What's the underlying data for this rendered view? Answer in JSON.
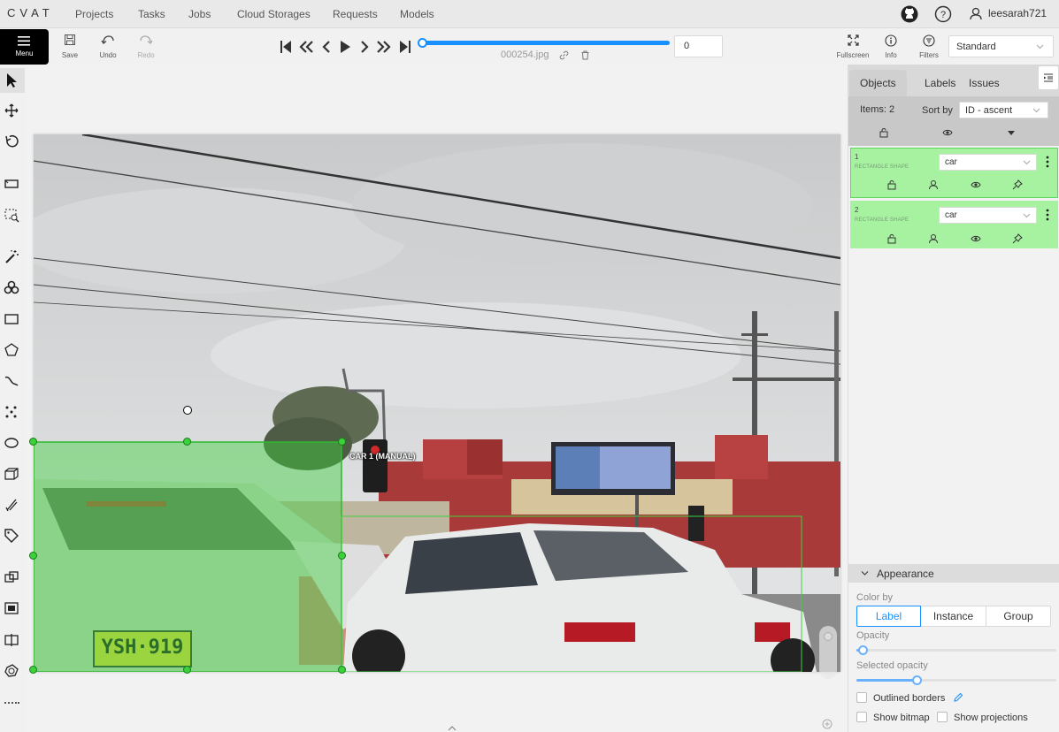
{
  "app": {
    "logo": "CVAT"
  },
  "nav": {
    "links": [
      "Projects",
      "Tasks",
      "Jobs",
      "Cloud Storages",
      "Requests",
      "Models"
    ],
    "username": "leesarah721"
  },
  "toolbar": {
    "menu_label": "Menu",
    "save_label": "Save",
    "undo_label": "Undo",
    "redo_label": "Redo",
    "filename": "000254.jpg",
    "frame_number": "0",
    "frame_progress": 0,
    "fullscreen_label": "Fullscreen",
    "info_label": "Info",
    "filters_label": "Filters",
    "workspace": "Standard"
  },
  "canvas": {
    "selected_label": "CAR 1 (MANUAL)"
  },
  "sidebar": {
    "tabs": [
      "Objects",
      "Labels",
      "Issues"
    ],
    "active_tab": "Objects",
    "items_count": "Items: 2",
    "sort_label": "Sort by",
    "sort_value": "ID - ascent",
    "objects": [
      {
        "id": "1",
        "type": "RECTANGLE SHAPE",
        "label": "car"
      },
      {
        "id": "2",
        "type": "RECTANGLE SHAPE",
        "label": "car"
      }
    ]
  },
  "appearance": {
    "title": "Appearance",
    "color_by_label": "Color by",
    "color_by_options": [
      "Label",
      "Instance",
      "Group"
    ],
    "color_by_selected": "Label",
    "opacity_label": "Opacity",
    "opacity_value": 0.03,
    "selected_opacity_label": "Selected opacity",
    "selected_opacity_value": 0.3,
    "outlined_borders_label": "Outlined borders",
    "outlined_borders_checked": false,
    "show_bitmap_label": "Show bitmap",
    "show_bitmap_checked": false,
    "show_projections_label": "Show projections",
    "show_projections_checked": false
  },
  "colors": {
    "accent": "#1890ff",
    "object_fill": "#a6f2a0",
    "box_green": "#36c136"
  }
}
